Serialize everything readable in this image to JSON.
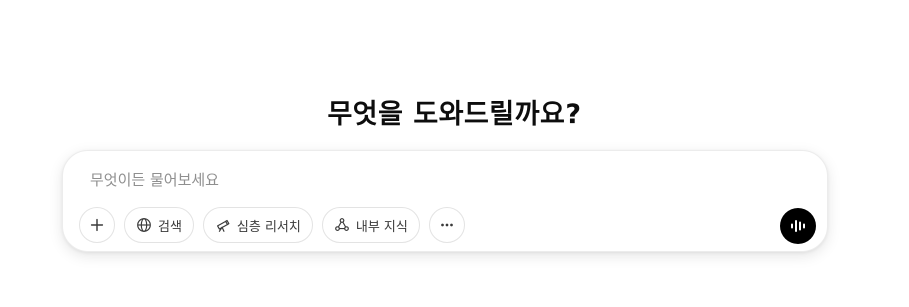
{
  "headline": "무엇을 도와드릴까요?",
  "composer": {
    "placeholder": "무엇이든 물어보세요",
    "value": ""
  },
  "toolbar": {
    "add": {
      "icon": "plus-icon"
    },
    "search": {
      "label": "검색",
      "icon": "globe-icon"
    },
    "deep_research": {
      "label": "심층 리서치",
      "icon": "telescope-icon"
    },
    "internal_knowledge": {
      "label": "내부 지식",
      "icon": "connectors-icon"
    },
    "more": {
      "icon": "ellipsis-icon"
    }
  },
  "voice": {
    "icon": "voice-waveform-icon",
    "bg": "#000000"
  }
}
